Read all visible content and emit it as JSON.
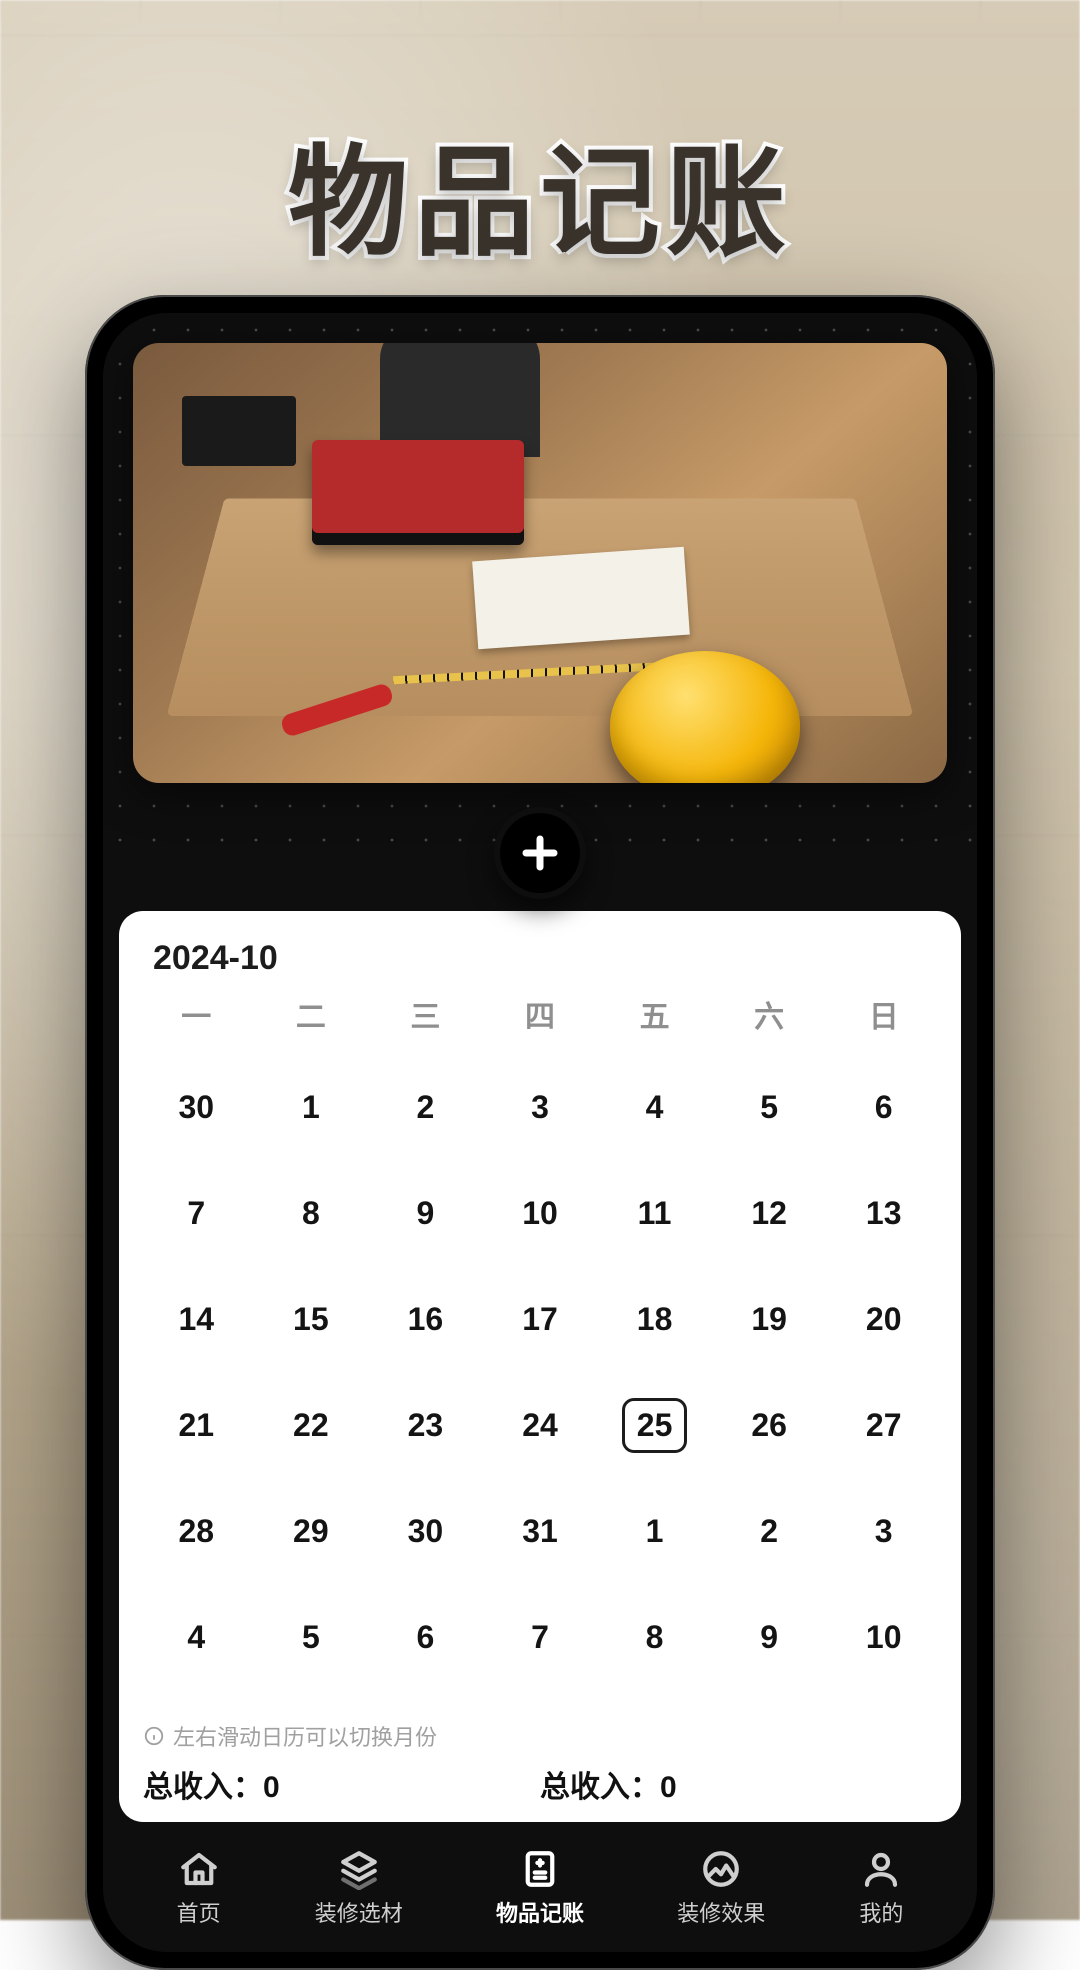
{
  "page_title": "物品记账",
  "calendar": {
    "month_label": "2024-10",
    "weekdays": [
      "一",
      "二",
      "三",
      "四",
      "五",
      "六",
      "日"
    ],
    "today": 25,
    "cells": [
      {
        "d": 30,
        "outside": true
      },
      {
        "d": 1
      },
      {
        "d": 2
      },
      {
        "d": 3
      },
      {
        "d": 4
      },
      {
        "d": 5
      },
      {
        "d": 6
      },
      {
        "d": 7
      },
      {
        "d": 8
      },
      {
        "d": 9
      },
      {
        "d": 10
      },
      {
        "d": 11
      },
      {
        "d": 12
      },
      {
        "d": 13
      },
      {
        "d": 14
      },
      {
        "d": 15
      },
      {
        "d": 16
      },
      {
        "d": 17
      },
      {
        "d": 18
      },
      {
        "d": 19
      },
      {
        "d": 20
      },
      {
        "d": 21
      },
      {
        "d": 22
      },
      {
        "d": 23
      },
      {
        "d": 24
      },
      {
        "d": 25
      },
      {
        "d": 26
      },
      {
        "d": 27
      },
      {
        "d": 28
      },
      {
        "d": 29
      },
      {
        "d": 30
      },
      {
        "d": 31
      },
      {
        "d": 1,
        "outside": true
      },
      {
        "d": 2,
        "outside": true
      },
      {
        "d": 3,
        "outside": true
      },
      {
        "d": 4,
        "outside": true
      },
      {
        "d": 5,
        "outside": true
      },
      {
        "d": 6,
        "outside": true
      },
      {
        "d": 7,
        "outside": true
      },
      {
        "d": 8,
        "outside": true
      },
      {
        "d": 9,
        "outside": true
      },
      {
        "d": 10,
        "outside": true
      }
    ],
    "hint": "左右滑动日历可以切换月份"
  },
  "totals": {
    "left_label": "总收入：",
    "left_value": "0",
    "right_label": "总收入：",
    "right_value": "0"
  },
  "nav": {
    "items": [
      {
        "key": "home",
        "label": "首页"
      },
      {
        "key": "material",
        "label": "装修选材"
      },
      {
        "key": "ledger",
        "label": "物品记账"
      },
      {
        "key": "effect",
        "label": "装修效果"
      },
      {
        "key": "mine",
        "label": "我的"
      }
    ],
    "active_key": "ledger"
  },
  "icons": {
    "add": "plus-icon",
    "info": "info-icon"
  }
}
